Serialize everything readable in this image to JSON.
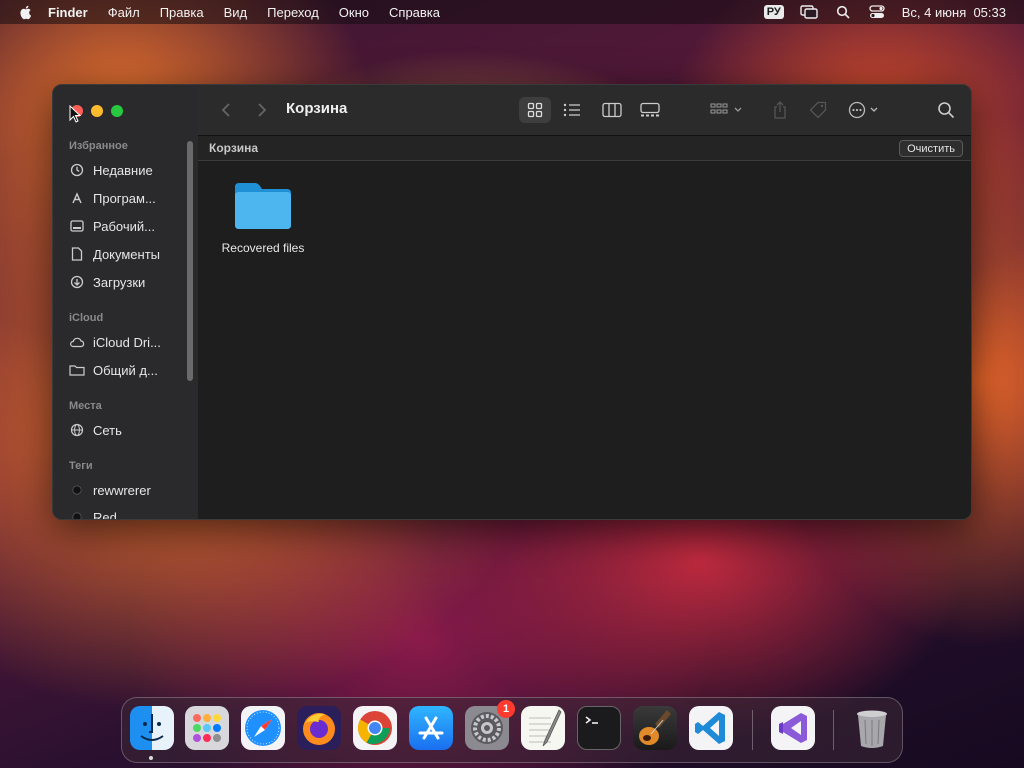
{
  "menubar": {
    "app_name": "Finder",
    "items": [
      "Файл",
      "Правка",
      "Вид",
      "Переход",
      "Окно",
      "Справка"
    ],
    "input_language": "РУ",
    "datetime": "Вс, 4 июня  05:33"
  },
  "finder": {
    "title": "Корзина",
    "pathbar_label": "Корзина",
    "clear_button": "Очистить",
    "sidebar": {
      "favorites_header": "Избранное",
      "favorites": [
        "Недавние",
        "Програм...",
        "Рабочий...",
        "Документы",
        "Загрузки"
      ],
      "icloud_header": "iCloud",
      "icloud": [
        "iCloud Dri...",
        "Общий д..."
      ],
      "places_header": "Места",
      "places": [
        "Сеть"
      ],
      "tags_header": "Теги",
      "tags": [
        "rewwrerer",
        "Red"
      ]
    },
    "files": [
      {
        "name": "Recovered files",
        "icon": "folder-icon"
      }
    ]
  },
  "dock": {
    "apps": [
      "Finder",
      "Launchpad",
      "Safari",
      "Firefox",
      "Chrome",
      "App Store",
      "System Settings",
      "TextEdit",
      "Terminal",
      "GarageBand",
      "VS Code",
      "Visual Studio",
      "Trash"
    ],
    "settings_badge": "1"
  },
  "colors": {
    "close": "#ff5f57",
    "minimize": "#febc2e",
    "maximize": "#28c840",
    "folder": "#3aa8e6",
    "badge": "#ff3b30"
  }
}
